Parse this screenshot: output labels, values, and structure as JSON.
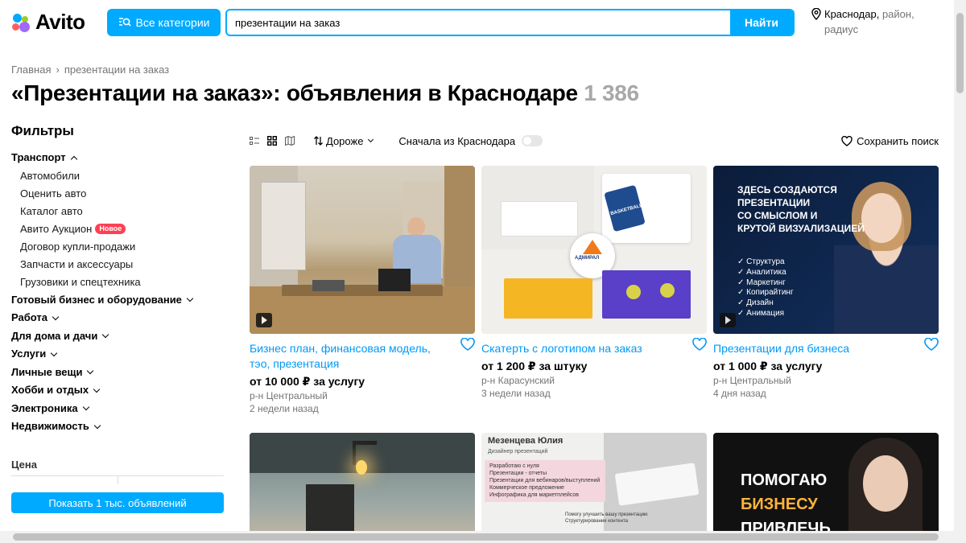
{
  "header": {
    "logo_text": "Avito",
    "categories_button": "Все категории",
    "search_value": "презентации на заказ",
    "search_button": "Найти",
    "location_city": "Краснодар,",
    "location_rest_1": "район,",
    "location_rest_2": "радиус"
  },
  "breadcrumb": [
    "Главная",
    "презентации на заказ"
  ],
  "page_title": "«Презентации на заказ»: объявления в Краснодаре",
  "result_count": "1 386",
  "sidebar": {
    "filters_title": "Фильтры",
    "transport_label": "Транспорт",
    "transport_items": [
      "Автомобили",
      "Оценить авто",
      "Каталог авто",
      "Авито Аукцион",
      "Договор купли-продажи",
      "Запчасти и аксессуары",
      "Грузовики и спецтехника"
    ],
    "new_badge": "Новое",
    "categories": [
      "Готовый бизнес и оборудование",
      "Работа",
      "Для дома и дачи",
      "Услуги",
      "Личные вещи",
      "Хобби и отдых",
      "Электроника",
      "Недвижимость"
    ],
    "price_label": "Цена",
    "show_button": "Показать 1 тыс. объявлений"
  },
  "toolbar": {
    "sort_label": "Дороже",
    "from_city_label": "Сначала из Краснодара",
    "save_search_label": "Сохранить поиск"
  },
  "listings": [
    {
      "title": "Бизнес план, финансовая модель, тэо, презентация",
      "price": "от 10 000 ₽ за услугу",
      "location": "р-н Центральный",
      "date": "2 недели назад"
    },
    {
      "title": "Скатерть с логотипом на заказ",
      "price": "от 1 200 ₽ за штуку",
      "location": "р-н Карасунский",
      "date": "3 недели назад"
    },
    {
      "title": "Презентации для бизнеса",
      "price": "от 1 000 ₽ за услугу",
      "location": "р-н Центральный",
      "date": "4 дня назад"
    }
  ],
  "images": {
    "promo1_lines": [
      "Здесь создаются",
      "презентации",
      "со смыслом и",
      "крутой визуализацией"
    ],
    "promo1_list": [
      "✓ Структура",
      "✓ Аналитика",
      "✓ Маркетинг",
      "✓ Копирайтинг",
      "✓ Дизайн",
      "✓ Анимация"
    ],
    "cv_name": "Мезенцева Юлия",
    "cv_role": "Дизайнер презентаций",
    "cv_heading": "Разработаю с нуля",
    "cv_items": [
      "Презентации - отчеты",
      "Презентации для вебинаров/выступлений",
      "Коммерческое предложение",
      "Инфографика для маркетплейсов"
    ],
    "cv_footer": [
      "Помогу улучшить вашу презентацию",
      "Структурирование контента"
    ],
    "promo2_lines": [
      "Помогаю",
      "бизнесу",
      "привлечь"
    ],
    "tablecloth_brand": "АДМИРАЛ",
    "tablecloth_basket": "BASKETBALL"
  },
  "colors": {
    "accent": "#00aaff",
    "link": "#0099f7",
    "badge": "#ff4053"
  }
}
